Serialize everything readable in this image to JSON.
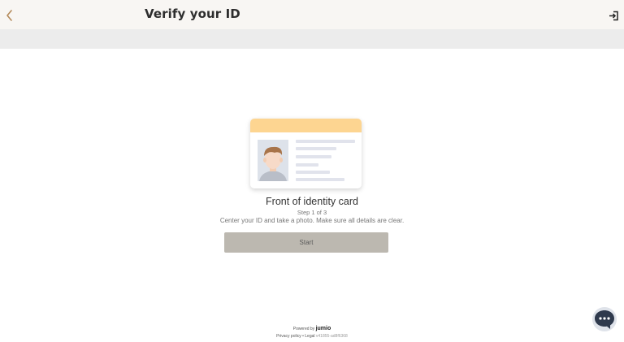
{
  "header": {
    "title": "Verify your ID",
    "back_icon": "chevron-left-icon",
    "exit_icon": "exit-icon"
  },
  "document": {
    "title": "Front of identity card",
    "step": "Step 1 of 3",
    "instructions": "Center your ID and take a photo. Make sure all details are clear.",
    "start_label": "Start"
  },
  "footer": {
    "powered_by": "Powered by",
    "brand": "jumio",
    "privacy": "Privacy policy",
    "separator": "•",
    "legal": "Legal",
    "version": "v41855-ad8f6368"
  },
  "colors": {
    "accent": "#bcb8b0",
    "card_band": "#fdd591",
    "chat": "#2f3a4d",
    "header_bg": "#f8f6f3"
  }
}
